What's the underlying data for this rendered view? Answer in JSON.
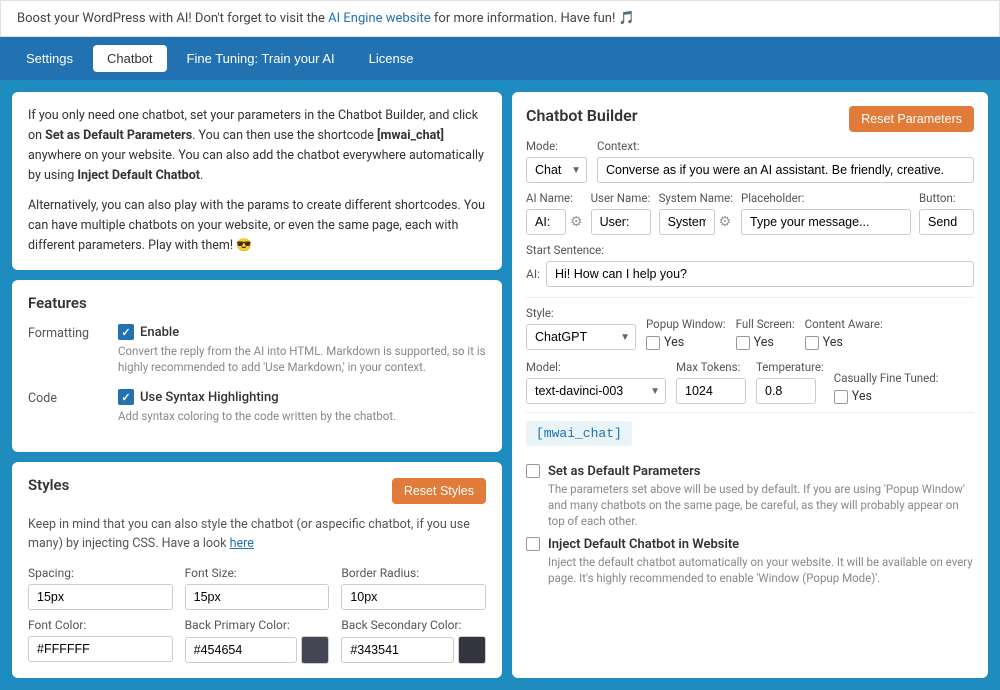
{
  "notice": {
    "text": "Boost your WordPress with AI! Don't forget to visit the ",
    "link_text": "AI Engine website",
    "text2": " for more information. Have fun! 🎵"
  },
  "nav": {
    "tabs": [
      {
        "id": "settings",
        "label": "Settings",
        "active": false
      },
      {
        "id": "chatbot",
        "label": "Chatbot",
        "active": true
      },
      {
        "id": "finetuning",
        "label": "Fine Tuning: Train your AI",
        "active": false
      },
      {
        "id": "license",
        "label": "License",
        "active": false
      }
    ]
  },
  "intro": {
    "text1": "If you only need one chatbot, set your parameters in the Chatbot Builder, and click on ",
    "bold1": "Set as Default Parameters",
    "text2": ". You can then use the shortcode ",
    "code1": "[mwai_chat]",
    "text3": " anywhere on your website. You can also add the chatbot everywhere automatically by using ",
    "bold2": "Inject Default Chatbot",
    "text4": ".",
    "text5": "Alternatively, you can also play with the params to create different shortcodes. You can have multiple chatbots on your website, or even the same page, each with different parameters. Play with them! 😎"
  },
  "features": {
    "title": "Features",
    "formatting": {
      "label": "Formatting",
      "checkbox_label": "Enable",
      "description": "Convert the reply from the AI into HTML. Markdown is supported, so it is highly recommended to add 'Use Markdown,' in your context.",
      "enabled": true
    },
    "code": {
      "label": "Code",
      "checkbox_label": "Use Syntax Highlighting",
      "description": "Add syntax coloring to the code written by the chatbot.",
      "enabled": true
    }
  },
  "styles": {
    "title": "Styles",
    "reset_label": "Reset Styles",
    "description": "Keep in mind that you can also style the chatbot (or aspecific chatbot, if you use many) by injecting CSS. Have a look ",
    "link_text": "here",
    "spacing_label": "Spacing:",
    "spacing_value": "15px",
    "font_size_label": "Font Size:",
    "font_size_value": "15px",
    "border_radius_label": "Border Radius:",
    "border_radius_value": "10px",
    "font_color_label": "Font Color:",
    "font_color_value": "#FFFFFF",
    "font_color_hex": "#ffffff",
    "back_primary_label": "Back Primary Color:",
    "back_primary_value": "#454654",
    "back_primary_hex": "#454654",
    "back_secondary_label": "Back Secondary Color:",
    "back_secondary_value": "#343541",
    "back_secondary_hex": "#343541"
  },
  "chatbot_builder": {
    "title": "Chatbot Builder",
    "reset_label": "Reset Parameters",
    "mode_label": "Mode:",
    "mode_value": "Chat",
    "context_label": "Context:",
    "context_value": "Converse as if you were an AI assistant. Be friendly, creative.",
    "ai_name_label": "AI Name:",
    "ai_name_value": "AI:",
    "ai_name_icon": "⚙",
    "user_name_label": "User Name:",
    "user_name_value": "User:",
    "system_name_label": "System Name:",
    "system_name_value": "System:",
    "system_name_icon": "⚙",
    "placeholder_label": "Placeholder:",
    "placeholder_value": "Type your message...",
    "button_label": "Button:",
    "button_value": "Send",
    "start_sentence_label": "Start Sentence:",
    "start_sentence_ai": "AI:",
    "start_sentence_value": "Hi! How can I help you?",
    "style_label": "Style:",
    "style_value": "ChatGPT",
    "popup_window_label": "Popup Window:",
    "popup_window_value": "Yes",
    "full_screen_label": "Full Screen:",
    "full_screen_value": "Yes",
    "content_aware_label": "Content Aware:",
    "content_aware_value": "Yes",
    "model_label": "Model:",
    "model_value": "text-davinci-003",
    "max_tokens_label": "Max Tokens:",
    "max_tokens_value": "1024",
    "temperature_label": "Temperature:",
    "temperature_value": "0.8",
    "casually_fine_tuned_label": "Casually Fine Tuned:",
    "casually_fine_tuned_value": "Yes",
    "shortcode": "[mwai_chat]",
    "set_default_label": "Set as Default Parameters",
    "set_default_desc": "The parameters set above will be used by default. If you are using 'Popup Window' and many chatbots on the same page, be careful, as they will probably appear on top of each other.",
    "inject_label": "Inject Default Chatbot in Website",
    "inject_desc": "Inject the default chatbot automatically on your website. It will be available on every page. It's highly recommended to enable 'Window (Popup Mode)'."
  }
}
